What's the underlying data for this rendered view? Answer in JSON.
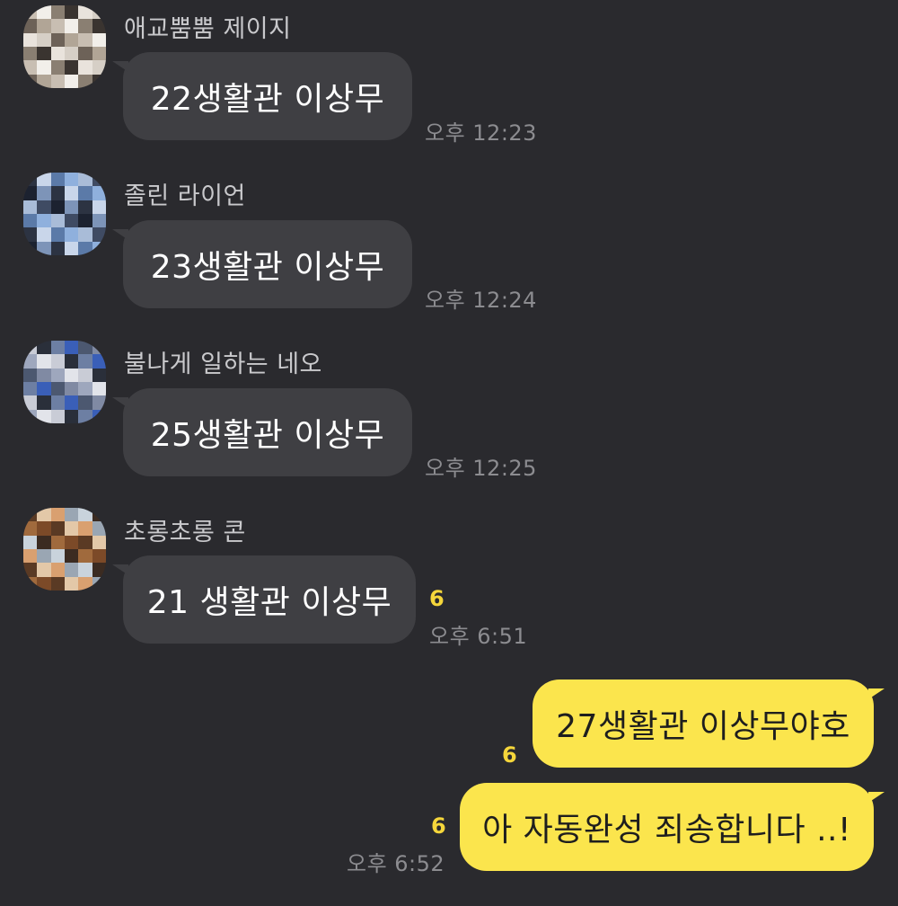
{
  "colors": {
    "background": "#2a2a2e",
    "incoming_bubble": "#3f3f43",
    "outgoing_bubble": "#fbe54d",
    "unread_count": "#f5d63b",
    "timestamp": "#8c8c90"
  },
  "messages": [
    {
      "sender": "애교뿜뿜 제이지",
      "text": "22생활관 이상무",
      "time": "오후 12:23",
      "avatar_icon": "pixelated-avatar-icon"
    },
    {
      "sender": "졸린 라이언",
      "text": "23생활관 이상무",
      "time": "오후 12:24",
      "avatar_icon": "pixelated-avatar-icon"
    },
    {
      "sender": "불나게 일하는 네오",
      "text": "25생활관 이상무",
      "time": "오후 12:25",
      "avatar_icon": "pixelated-avatar-icon"
    },
    {
      "sender": "초롱초롱 콘",
      "text": "21 생활관 이상무",
      "time": "오후 6:51",
      "unread": "6",
      "avatar_icon": "pixelated-avatar-icon"
    }
  ],
  "outgoing": [
    {
      "text": "27생활관 이상무야호",
      "unread": "6"
    },
    {
      "text": "아 자동완성 죄송합니다 ..!",
      "unread": "6",
      "time": "오후 6:52"
    }
  ]
}
